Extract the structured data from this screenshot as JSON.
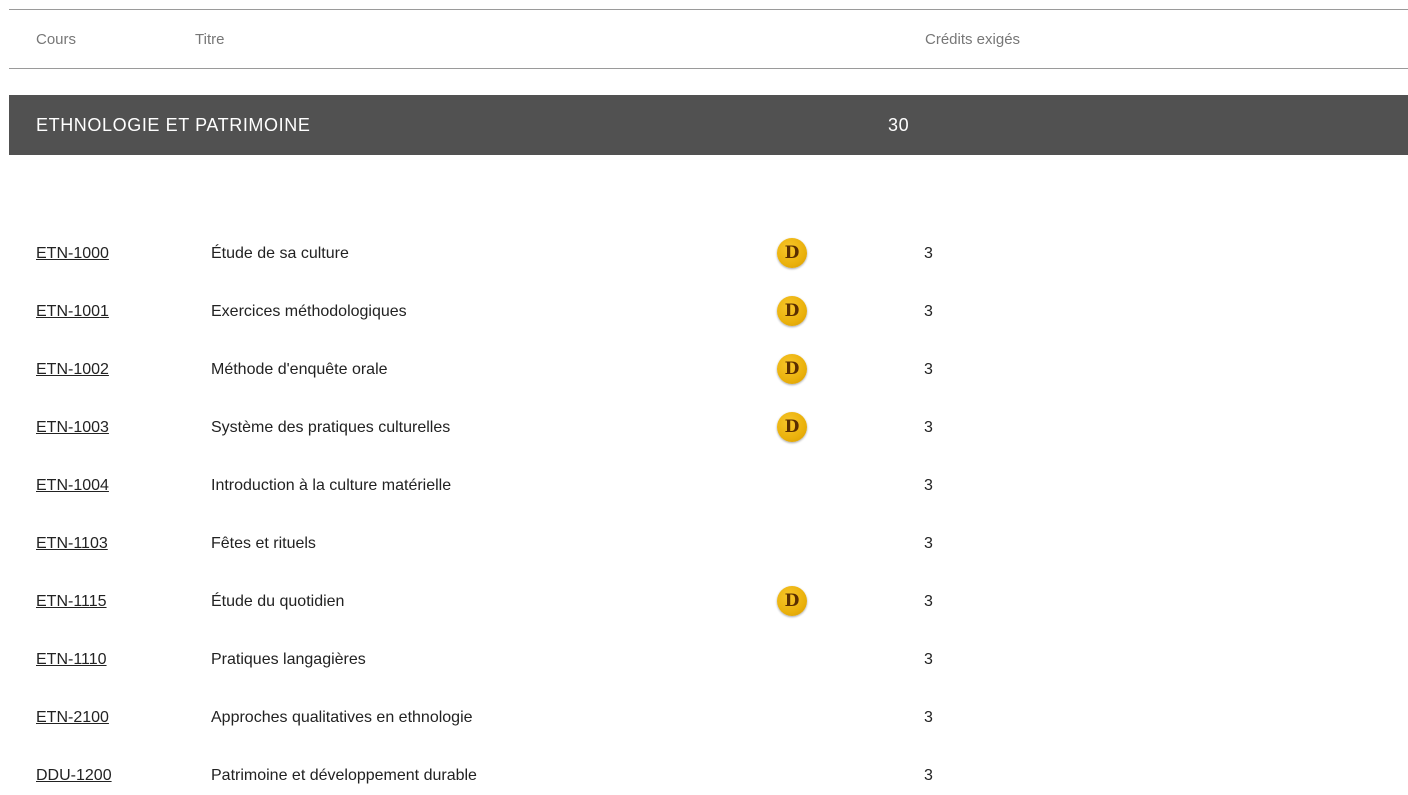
{
  "columns": {
    "cours": "Cours",
    "titre": "Titre",
    "credits": "Crédits exigés"
  },
  "section": {
    "title": "ETHNOLOGIE ET PATRIMOINE",
    "credits": "30"
  },
  "badge_letter": "D",
  "colors": {
    "section_bar": "#515151",
    "badge": "#eab10c"
  },
  "courses": [
    {
      "code": "ETN-1000",
      "title": "Étude de sa culture",
      "badge": true,
      "credits": "3"
    },
    {
      "code": "ETN-1001",
      "title": "Exercices méthodologiques",
      "badge": true,
      "credits": "3"
    },
    {
      "code": "ETN-1002",
      "title": "Méthode d'enquête orale",
      "badge": true,
      "credits": "3"
    },
    {
      "code": "ETN-1003",
      "title": "Système des pratiques culturelles",
      "badge": true,
      "credits": "3"
    },
    {
      "code": "ETN-1004",
      "title": "Introduction à la culture matérielle",
      "badge": false,
      "credits": "3"
    },
    {
      "code": "ETN-1103",
      "title": "Fêtes et rituels",
      "badge": false,
      "credits": "3"
    },
    {
      "code": "ETN-1115",
      "title": "Étude du quotidien",
      "badge": true,
      "credits": "3"
    },
    {
      "code": "ETN-1110",
      "title": "Pratiques langagières",
      "badge": false,
      "credits": "3"
    },
    {
      "code": "ETN-2100",
      "title": "Approches qualitatives en ethnologie",
      "badge": false,
      "credits": "3"
    },
    {
      "code": "DDU-1200",
      "title": "Patrimoine et développement durable",
      "badge": false,
      "credits": "3"
    }
  ]
}
